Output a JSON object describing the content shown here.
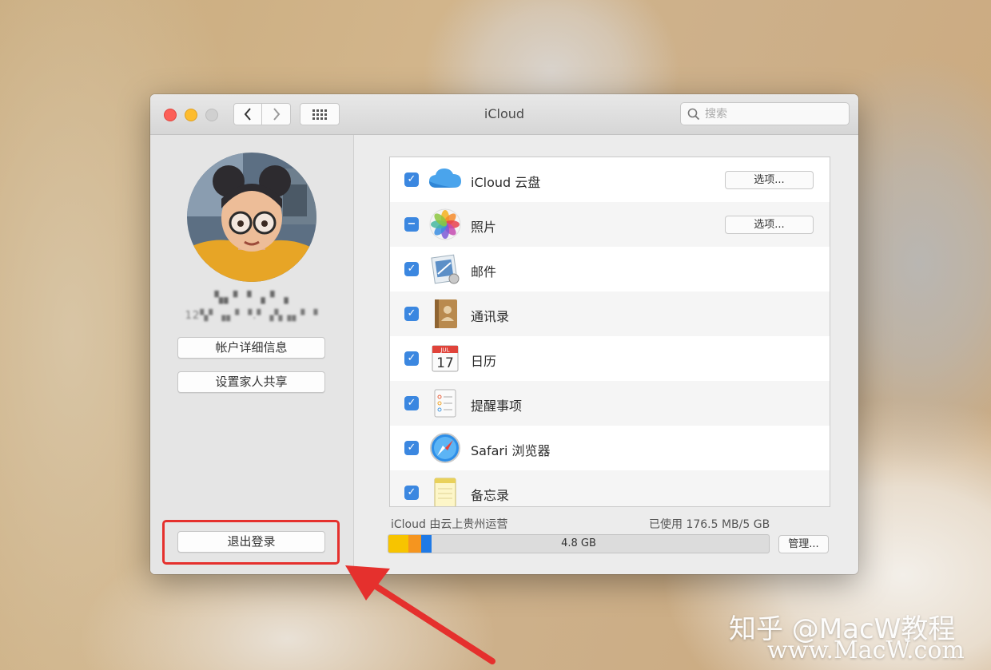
{
  "window": {
    "title": "iCloud",
    "search_placeholder": "搜索"
  },
  "sidebar": {
    "account_name": "▚▖▘▝ ▗ ▘▗",
    "account_email": "12▚▘▗▖▘▝.▘▗▚▗▖▘▝",
    "account_details_button": "帐户详细信息",
    "family_sharing_button": "设置家人共享",
    "sign_out_button": "退出登录"
  },
  "services": [
    {
      "label": "iCloud 云盘",
      "state": "checked",
      "icon": "icloud-drive-icon",
      "option": "选项..."
    },
    {
      "label": "照片",
      "state": "mixed",
      "icon": "photos-icon",
      "option": "选项..."
    },
    {
      "label": "邮件",
      "state": "checked",
      "icon": "mail-icon"
    },
    {
      "label": "通讯录",
      "state": "checked",
      "icon": "contacts-icon"
    },
    {
      "label": "日历",
      "state": "checked",
      "icon": "calendar-icon",
      "icon_text": {
        "month": "JUL",
        "day": "17"
      }
    },
    {
      "label": "提醒事项",
      "state": "checked",
      "icon": "reminders-icon"
    },
    {
      "label": "Safari 浏览器",
      "state": "checked",
      "icon": "safari-icon"
    },
    {
      "label": "备忘录",
      "state": "checked",
      "icon": "notes-icon"
    }
  ],
  "storage": {
    "provider_text": "iCloud 由云上贵州运营",
    "usage_text": "已使用 176.5 MB/5 GB",
    "bar_label": "4.8 GB",
    "manage_button": "管理...",
    "segments": [
      {
        "name": "yellow",
        "color": "#f7c400",
        "fraction": 0.052
      },
      {
        "name": "orange",
        "color": "#f5951f",
        "fraction": 0.034
      },
      {
        "name": "blue",
        "color": "#1f7ae6",
        "fraction": 0.027
      }
    ]
  },
  "watermark": {
    "line1": "知乎 @MacW教程",
    "line2": "www.MacW.com"
  }
}
